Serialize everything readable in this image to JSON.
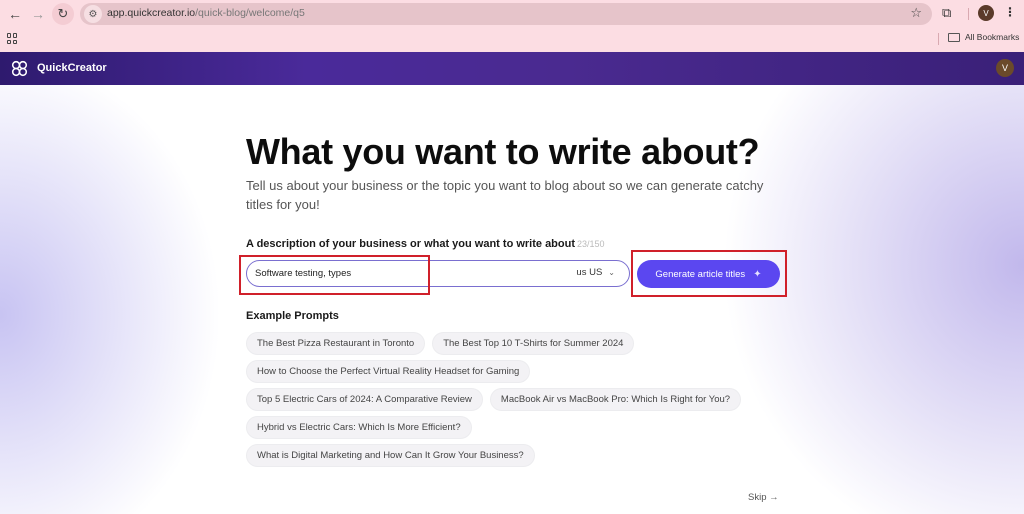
{
  "browser": {
    "url_domain": "app.quickcreator.io",
    "url_path": "/quick-blog/welcome/q5",
    "profile_initial": "V",
    "bookmarks_label": "All Bookmarks",
    "icons": {
      "back": "←",
      "forward": "→",
      "reload": "↻",
      "site_info": "⚙",
      "star": "☆",
      "extensions": "⧉",
      "menu": "⋮"
    }
  },
  "app": {
    "brand": "QuickCreator",
    "user_initial": "V"
  },
  "page": {
    "title": "What you want to write about?",
    "subtitle": "Tell us about your business or the topic you want to blog about so we can generate catchy titles for you!",
    "field_label": "A description of your business or what you want to write about",
    "char_count": "23/150",
    "input_value": "Software testing, types",
    "locale": "us US",
    "generate_label": "Generate article titles",
    "examples_title": "Example Prompts",
    "examples": [
      [
        "The Best Pizza Restaurant in Toronto",
        "The Best Top 10 T-Shirts for Summer 2024"
      ],
      [
        "How to Choose the Perfect Virtual Reality Headset for Gaming"
      ],
      [
        "Top 5 Electric Cars of 2024: A Comparative Review",
        "MacBook Air vs MacBook Pro: Which Is Right for You?"
      ],
      [
        "Hybrid vs Electric Cars: Which Is More Efficient?"
      ],
      [
        "What is Digital Marketing and How Can It Grow Your Business?"
      ]
    ],
    "skip_label": "Skip →"
  },
  "colors": {
    "accent": "#5b47f0",
    "header": "#4a2a9a",
    "annotation": "#d0202a"
  }
}
